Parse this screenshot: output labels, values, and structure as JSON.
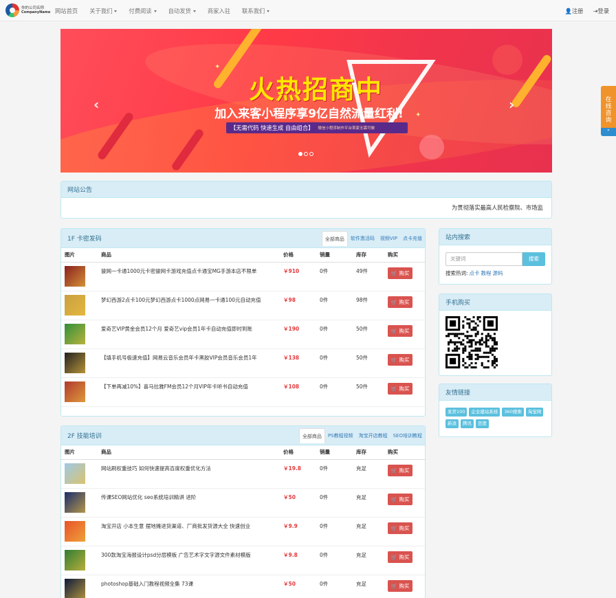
{
  "brand": {
    "name_cn": "你的公司名称",
    "name_en": "CompanyName"
  },
  "nav": {
    "items": [
      {
        "label": "网站首页",
        "dropdown": false
      },
      {
        "label": "关于我们",
        "dropdown": true
      },
      {
        "label": "付费阅读",
        "dropdown": true
      },
      {
        "label": "自动发货",
        "dropdown": true
      },
      {
        "label": "商家入驻",
        "dropdown": false
      },
      {
        "label": "联系我们",
        "dropdown": true
      }
    ],
    "register": "注册",
    "login": "登录"
  },
  "banner": {
    "title": "火热招商中",
    "subtitle": "加入来客小程序享9亿自然流量红利!",
    "pill_main": "【无需代码  快速生成  自由组合】",
    "pill_note": "微信小程序制作平台首家无需可做",
    "prev": "‹",
    "next": "›",
    "slides": 3,
    "active_slide": 0
  },
  "float": {
    "consult": [
      "在",
      "线",
      "咨",
      "询"
    ],
    "tab": "»"
  },
  "notice": {
    "title": "网站公告",
    "text": "为贯彻落实最高人民检察院、市场监"
  },
  "section1": {
    "title": "1F 卡密发码",
    "tabs": [
      "全部商品",
      "软件激活码",
      "视频VIP",
      "点卡充值"
    ],
    "headers": {
      "pic": "图片",
      "name": "商品",
      "price": "价格",
      "sales": "销量",
      "stock": "库存",
      "buy": "购买"
    },
    "rows": [
      {
        "name": "骏网一卡通1000元卡密骏网卡游戏充值点卡通宝MG手游本店不限单",
        "price": "￥910",
        "sales": "0件",
        "stock": "49件",
        "buy": "购买",
        "thumb": "#8a1f1f"
      },
      {
        "name": "梦幻西游2点卡100元梦幻西游点卡1000点网易一卡通100元自动充值",
        "price": "￥98",
        "sales": "0件",
        "stock": "98件",
        "buy": "购买",
        "thumb": "#c8a040"
      },
      {
        "name": "爱奇艺VIP黄金会员12个月 爱奇艺vip会员1年卡自动充值即时到账",
        "price": "￥190",
        "sales": "0件",
        "stock": "50件",
        "buy": "购买",
        "thumb": "#2f8f3a"
      },
      {
        "name": "【填手机号极速充值】网易云音乐会员年卡黑胶VIP会员音乐会员1年",
        "price": "￥138",
        "sales": "0件",
        "stock": "50件",
        "buy": "购买",
        "thumb": "#222222"
      },
      {
        "name": "【下单再减10%】喜马拉雅FM会员12个月VIP年卡听书自动充值",
        "price": "￥108",
        "sales": "0件",
        "stock": "50件",
        "buy": "购买",
        "thumb": "#b03a2e"
      }
    ]
  },
  "section2": {
    "title": "2F 技能培训",
    "tabs": [
      "全部商品",
      "PS教程视频",
      "淘宝开店教程",
      "SEO培训教程"
    ],
    "headers": {
      "pic": "图片",
      "name": "商品",
      "price": "价格",
      "sales": "销量",
      "stock": "库存",
      "buy": "购买"
    },
    "rows": [
      {
        "name": "网站刷权重技巧 如何快速提高百度权重优化方法",
        "price": "￥19.8",
        "sales": "0件",
        "stock": "充足",
        "buy": "购买",
        "thumb": "#9ec9e6"
      },
      {
        "name": "传课SEO网站优化 seo系统培训精讲 进阶",
        "price": "￥50",
        "sales": "0件",
        "stock": "充足",
        "buy": "购买",
        "thumb": "#1a2d6b"
      },
      {
        "name": "淘宝开店 小本生意 摆地摊进货渠道、厂商批发货源大全 快速创业",
        "price": "￥9.9",
        "sales": "0件",
        "stock": "充足",
        "buy": "购买",
        "thumb": "#e8532a"
      },
      {
        "name": "300款淘宝海报设计psd分层模板 广告艺术字文字源文件素材模版",
        "price": "￥9.8",
        "sales": "0件",
        "stock": "充足",
        "buy": "购买",
        "thumb": "#2e7d32"
      },
      {
        "name": "photoshop基础入门教程视频全集 73课",
        "price": "￥50",
        "sales": "0件",
        "stock": "充足",
        "buy": "购买",
        "thumb": "#0d1b3a"
      }
    ]
  },
  "sidebar": {
    "search_title": "站内搜索",
    "search_placeholder": "关键词",
    "search_button": "搜索",
    "hot_label": "搜索热词:",
    "hot_words": [
      "点卡",
      "教程",
      "源码"
    ],
    "mobile_title": "手机购买",
    "links_title": "友情链接",
    "links": [
      "发货100",
      "企业建站系统",
      "360搜索",
      "淘宝网",
      "新浪",
      "腾讯",
      "百度"
    ]
  }
}
